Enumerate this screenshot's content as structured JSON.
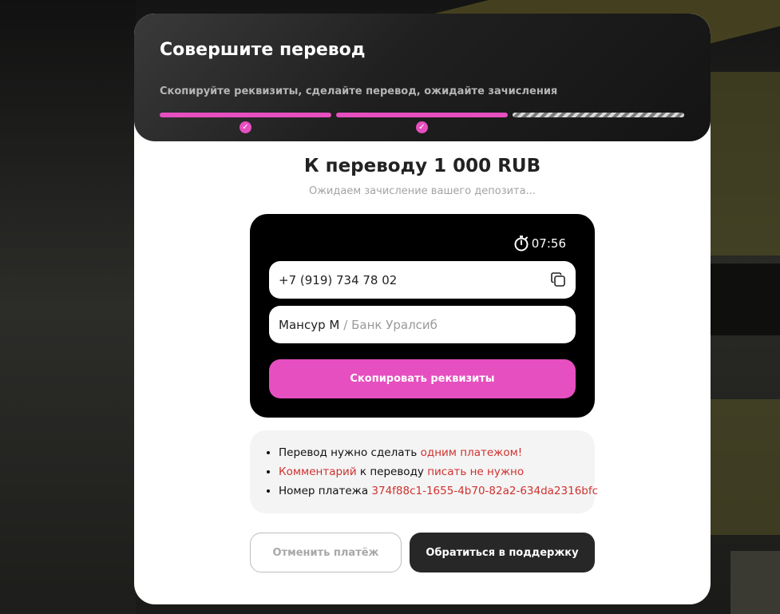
{
  "header": {
    "title": "Совершите перевод",
    "subtitle": "Скопируйте реквизиты, сделайте перевод, ожидайте зачисления",
    "steps": [
      {
        "status": "done",
        "icon": "check-icon"
      },
      {
        "status": "done",
        "icon": "check-icon"
      },
      {
        "status": "pending"
      }
    ]
  },
  "transfer": {
    "title": "К переводу 1 000 RUB",
    "status_text": "Ожидаем зачисление вашего депозита..."
  },
  "card": {
    "timer": "07:56",
    "timer_icon": "stopwatch-icon",
    "phone": "+7 (919) 734 78 02",
    "copy_icon": "copy-icon",
    "recipient_name": "Мансур М",
    "bank_name": "/ Банк Уралсиб",
    "copy_button_label": "Скопировать реквизиты"
  },
  "info": {
    "item1_prefix": "Перевод нужно сделать ",
    "item1_highlight": "одним платежом!",
    "item2_highlight_a": "Комментарий",
    "item2_middle": " к переводу ",
    "item2_highlight_b": "писать не нужно",
    "item3_prefix": "Номер платежа ",
    "item3_value": "374f88c1-1655-4b70-82a2-634da2316bfc"
  },
  "actions": {
    "cancel_label": "Отменить платёж",
    "support_label": "Обратиться в поддержку"
  },
  "colors": {
    "accent": "#e64fbf",
    "highlight": "#d0322f",
    "dark": "#272727"
  }
}
